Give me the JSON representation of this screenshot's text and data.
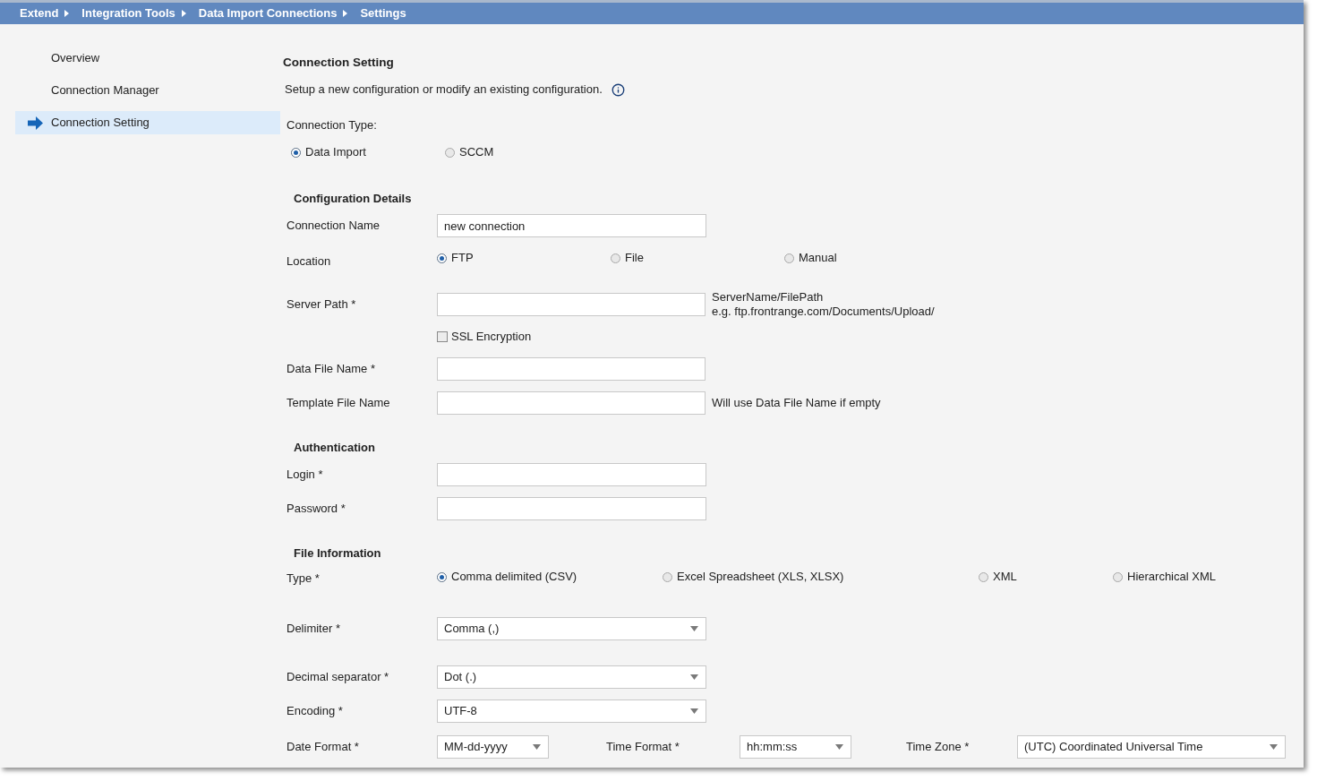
{
  "breadcrumb": [
    {
      "label": "Extend"
    },
    {
      "label": "Integration Tools"
    },
    {
      "label": "Data Import Connections"
    },
    {
      "label": "Settings"
    }
  ],
  "sidebar": {
    "items": [
      {
        "label": "Overview",
        "selected": false
      },
      {
        "label": "Connection Manager",
        "selected": false
      },
      {
        "label": "Connection Setting",
        "selected": true
      }
    ]
  },
  "main": {
    "title": "Connection Setting",
    "description": "Setup a new configuration or modify an existing configuration.",
    "connection_type": {
      "label": "Connection Type:",
      "options": [
        {
          "label": "Data Import",
          "selected": true
        },
        {
          "label": "SCCM",
          "selected": false
        }
      ]
    },
    "configuration_details": {
      "heading": "Configuration Details",
      "connection_name": {
        "label": "Connection Name",
        "value": "new connection"
      },
      "location": {
        "label": "Location",
        "options": [
          {
            "label": "FTP",
            "selected": true
          },
          {
            "label": "File",
            "selected": false
          },
          {
            "label": "Manual",
            "selected": false
          }
        ]
      },
      "server_path": {
        "label": "Server Path *",
        "hints": [
          "ServerName/FilePath",
          "e.g. ftp.frontrange.com/Documents/Upload/"
        ]
      },
      "ssl_encryption": {
        "label": "SSL Encryption",
        "checked": false
      },
      "data_file_name": {
        "label": "Data File Name *"
      },
      "template_file_name": {
        "label": "Template File Name",
        "hint": "Will use Data File Name if empty"
      }
    },
    "authentication": {
      "heading": "Authentication",
      "login": {
        "label": "Login *"
      },
      "password": {
        "label": "Password *"
      }
    },
    "file_information": {
      "heading": "File Information",
      "type": {
        "label": "Type *",
        "options": [
          {
            "label": "Comma delimited (CSV)",
            "selected": true
          },
          {
            "label": "Excel Spreadsheet (XLS, XLSX)",
            "selected": false
          },
          {
            "label": "XML",
            "selected": false
          },
          {
            "label": "Hierarchical XML",
            "selected": false
          }
        ]
      },
      "delimiter": {
        "label": "Delimiter *",
        "value": "Comma (,)"
      },
      "decimal_separator": {
        "label": "Decimal separator *",
        "value": "Dot (.)"
      },
      "encoding": {
        "label": "Encoding *",
        "value": "UTF-8"
      },
      "date_format": {
        "label": "Date Format *",
        "value": "MM-dd-yyyy"
      },
      "time_format": {
        "label": "Time Format *",
        "value": "hh:mm:ss"
      },
      "time_zone": {
        "label": "Time Zone *",
        "value": "(UTC) Coordinated Universal Time"
      }
    }
  }
}
